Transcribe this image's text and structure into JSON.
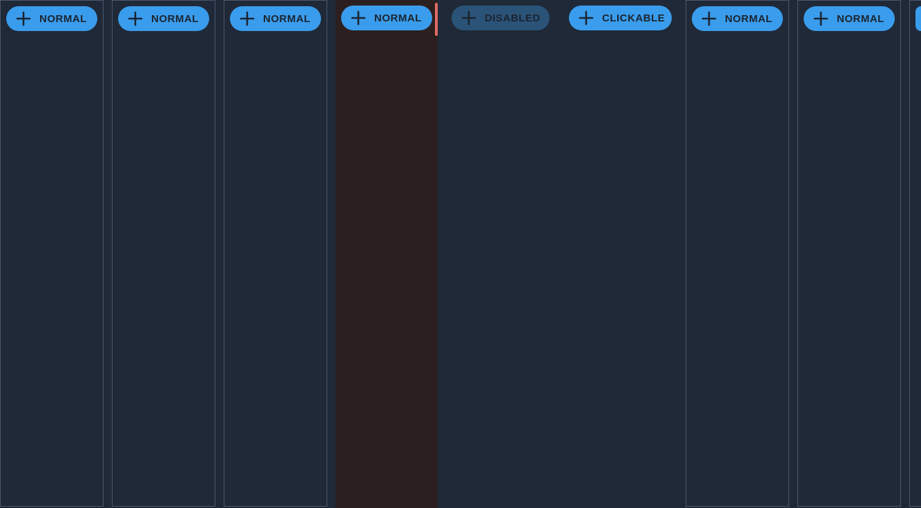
{
  "colors": {
    "background": "#1f2937",
    "column_border": "#4b5a70",
    "button": "#3a9cec",
    "button_disabled": "#2b5378",
    "button_text": "#1b2430",
    "highlight_column": "#2c1f1f",
    "highlight_marker": "#e06b63"
  },
  "buttons": {
    "b1": {
      "label": "NORMAL",
      "icon": "plus-icon",
      "state": "normal"
    },
    "b2": {
      "label": "NORMAL",
      "icon": "plus-icon",
      "state": "normal"
    },
    "b3": {
      "label": "NORMAL",
      "icon": "plus-icon",
      "state": "normal"
    },
    "b4": {
      "label": "NORMAL",
      "icon": "plus-icon",
      "state": "normal"
    },
    "b5": {
      "label": "DISABLED",
      "icon": "plus-icon",
      "state": "disabled"
    },
    "b6": {
      "label": "CLICKABLE",
      "icon": "plus-icon",
      "state": "normal"
    },
    "b7": {
      "label": "NORMAL",
      "icon": "plus-icon",
      "state": "normal"
    },
    "b8": {
      "label": "NORMAL",
      "icon": "plus-icon",
      "state": "normal"
    }
  }
}
